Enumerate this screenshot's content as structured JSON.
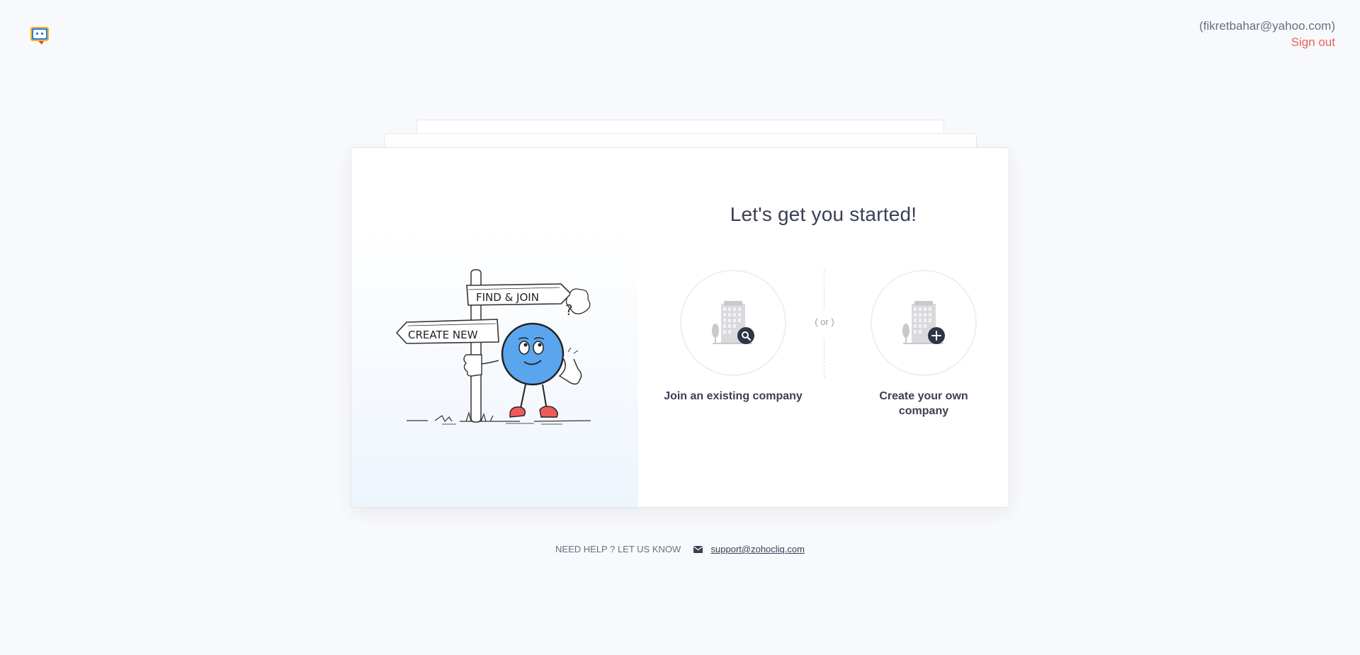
{
  "header": {
    "logo_icon": "cliq-logo-icon",
    "email": "(fikretbahar@yahoo.com)",
    "sign_out": "Sign out"
  },
  "main": {
    "title": "Let's get you started!",
    "illustration": {
      "sign_top": "FIND & JOIN",
      "sign_bottom": "CREATE NEW"
    },
    "options": [
      {
        "label": "Join an existing company",
        "icon": "building-search-icon"
      },
      {
        "label": "Create your own company",
        "icon": "building-add-icon"
      }
    ],
    "divider_text": "( or )"
  },
  "footer": {
    "help_text": "NEED HELP ? LET US KNOW",
    "support_email": "support@zohocliq.com",
    "mail_icon": "mail-icon"
  },
  "colors": {
    "accent": "#e8615a",
    "character_blue": "#5aa6ee",
    "shoes": "#ef5b5b",
    "badge_dark": "#2f3547"
  }
}
